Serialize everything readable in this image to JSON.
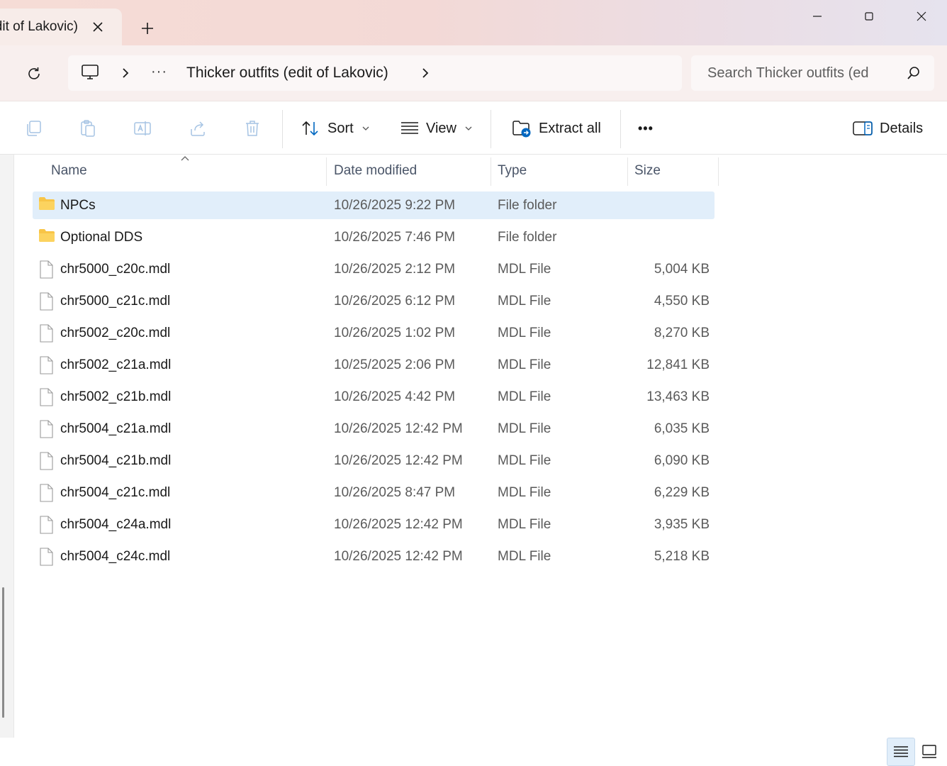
{
  "window": {
    "tab_title": "Thicker outfits (edit of Lakovic)",
    "tab_close_icon": "close-icon",
    "new_tab_icon": "plus-icon",
    "controls": [
      "minimize-icon",
      "maximize-icon",
      "close-icon"
    ]
  },
  "address": {
    "root_icon": "computer-icon",
    "overflow": "···",
    "crumb": "Thicker outfits (edit of Lakovic)"
  },
  "search": {
    "placeholder": "Search Thicker outfits (ed"
  },
  "toolbar": {
    "sort_label": "Sort",
    "view_label": "View",
    "extract_label": "Extract all",
    "more_label": "•••",
    "details_label": "Details"
  },
  "columns": {
    "name": "Name",
    "date": "Date modified",
    "type": "Type",
    "size": "Size"
  },
  "files": [
    {
      "name": "NPCs",
      "date": "10/26/2025 9:22 PM",
      "type": "File folder",
      "size": "",
      "kind": "folder",
      "selected": true
    },
    {
      "name": "Optional DDS",
      "date": "10/26/2025 7:46 PM",
      "type": "File folder",
      "size": "",
      "kind": "folder",
      "selected": false
    },
    {
      "name": "chr5000_c20c.mdl",
      "date": "10/26/2025 2:12 PM",
      "type": "MDL File",
      "size": "5,004 KB",
      "kind": "file",
      "selected": false
    },
    {
      "name": "chr5000_c21c.mdl",
      "date": "10/26/2025 6:12 PM",
      "type": "MDL File",
      "size": "4,550 KB",
      "kind": "file",
      "selected": false
    },
    {
      "name": "chr5002_c20c.mdl",
      "date": "10/26/2025 1:02 PM",
      "type": "MDL File",
      "size": "8,270 KB",
      "kind": "file",
      "selected": false
    },
    {
      "name": "chr5002_c21a.mdl",
      "date": "10/25/2025 2:06 PM",
      "type": "MDL File",
      "size": "12,841 KB",
      "kind": "file",
      "selected": false
    },
    {
      "name": "chr5002_c21b.mdl",
      "date": "10/26/2025 4:42 PM",
      "type": "MDL File",
      "size": "13,463 KB",
      "kind": "file",
      "selected": false
    },
    {
      "name": "chr5004_c21a.mdl",
      "date": "10/26/2025 12:42 PM",
      "type": "MDL File",
      "size": "6,035 KB",
      "kind": "file",
      "selected": false
    },
    {
      "name": "chr5004_c21b.mdl",
      "date": "10/26/2025 12:42 PM",
      "type": "MDL File",
      "size": "6,090 KB",
      "kind": "file",
      "selected": false
    },
    {
      "name": "chr5004_c21c.mdl",
      "date": "10/26/2025 8:47 PM",
      "type": "MDL File",
      "size": "6,229 KB",
      "kind": "file",
      "selected": false
    },
    {
      "name": "chr5004_c24a.mdl",
      "date": "10/26/2025 12:42 PM",
      "type": "MDL File",
      "size": "3,935 KB",
      "kind": "file",
      "selected": false
    },
    {
      "name": "chr5004_c24c.mdl",
      "date": "10/26/2025 12:42 PM",
      "type": "MDL File",
      "size": "5,218 KB",
      "kind": "file",
      "selected": false
    }
  ],
  "colors": {
    "selection": "#e1eefa",
    "folder": "#f8c547",
    "accent": "#0067c0"
  }
}
